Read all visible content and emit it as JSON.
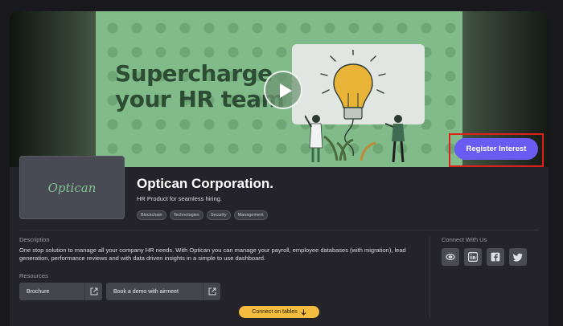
{
  "banner": {
    "headline_line1": "Supercharge",
    "headline_line2": "your HR team",
    "register_label": "Register Interest"
  },
  "company": {
    "logo_text": "Optican",
    "name": "Optican Corporation.",
    "tagline": "HR Product for seamless hiring.",
    "tags": [
      "Blockchain",
      "Technologies",
      "Security",
      "Management"
    ]
  },
  "description": {
    "label": "Description",
    "text": "One stop solution to manage all your company HR needs. With Optican you can manage your payroll, employee databases (with migration), lead generation, performance reviews and with data driven insights in a simple to use dashboard."
  },
  "resources": {
    "label": "Resources",
    "items": [
      "Brochure",
      "Book a demo with airmeet"
    ]
  },
  "connect": {
    "label": "Connect With Us",
    "socials": [
      "website-icon",
      "linkedin-icon",
      "facebook-icon",
      "twitter-icon"
    ]
  },
  "footer": {
    "connect_tables_label": "Connect on tables"
  },
  "colors": {
    "accent": "#6a5bf3",
    "banner_green": "#81bb89",
    "connect_pill": "#f3bc3e",
    "highlight": "#e0201a"
  }
}
